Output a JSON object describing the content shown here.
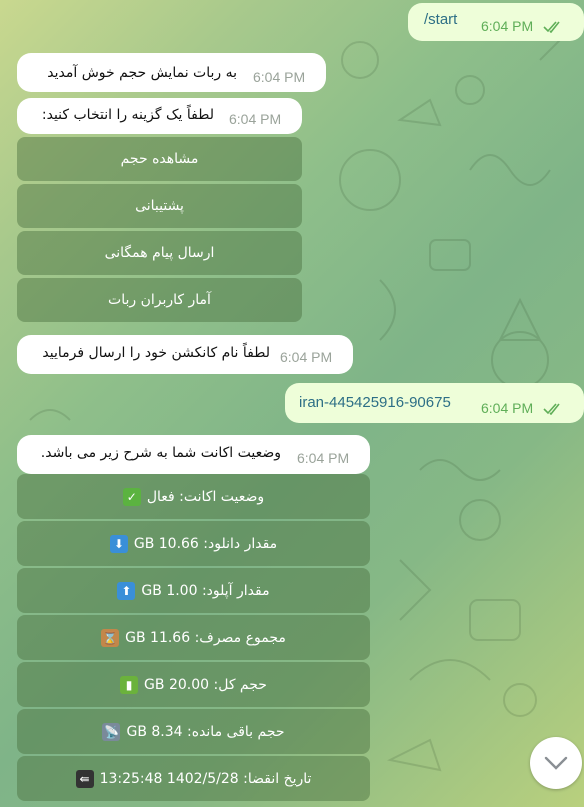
{
  "messages": {
    "start": {
      "text": "/start",
      "time": "6:04 PM"
    },
    "welcome": {
      "text": "به ربات نمایش حجم خوش آمدید",
      "time": "6:04 PM"
    },
    "choose": {
      "text": "لطفاً یک گزینه را انتخاب کنید:",
      "time": "6:04 PM"
    },
    "send_name": {
      "text": "لطفاً نام کانکشن خود را ارسال فرمایید",
      "time": "6:04 PM"
    },
    "connection": {
      "text": "iran-445425916-90675",
      "time": "6:04 PM"
    },
    "status": {
      "text": "وضعیت اکانت شما به شرح زیر می باشد.",
      "time": "6:04 PM"
    }
  },
  "menu_buttons": [
    "مشاهده حجم",
    "پشتیبانی",
    "ارسال پیام همگانی",
    "آمار کاربران ربات"
  ],
  "account_buttons": [
    {
      "label": "وضعیت اکانت: فعال",
      "icon": "check-mark-icon",
      "color": "#5bb340",
      "glyph": "✓"
    },
    {
      "label": "مقدار دانلود: 10.66 GB",
      "icon": "down-arrow-icon",
      "color": "#3a8fd8",
      "glyph": "⬇"
    },
    {
      "label": "مقدار آپلود: 1.00 GB",
      "icon": "up-arrow-icon",
      "color": "#3a8fd8",
      "glyph": "⬆"
    },
    {
      "label": "مجموع مصرف: 11.66 GB",
      "icon": "hourglass-icon",
      "color": "#c2874a",
      "glyph": "⌛"
    },
    {
      "label": "حجم کل: 20.00 GB",
      "icon": "battery-icon",
      "color": "#6bb23c",
      "glyph": "▮"
    },
    {
      "label": "حجم باقی مانده: 8.34 GB",
      "icon": "satellite-icon",
      "color": "#7a8a9a",
      "glyph": "📡"
    },
    {
      "label": "تاریخ انقضا: 1402/5/28 13:25:48",
      "icon": "end-arrow-icon",
      "color": "#333333",
      "glyph": "⇚"
    }
  ],
  "colors": {
    "incoming": "#ffffff",
    "outgoing": "#eefed9",
    "check": "#5fae58",
    "button_bg": "rgba(74,110,62,0.45)"
  }
}
